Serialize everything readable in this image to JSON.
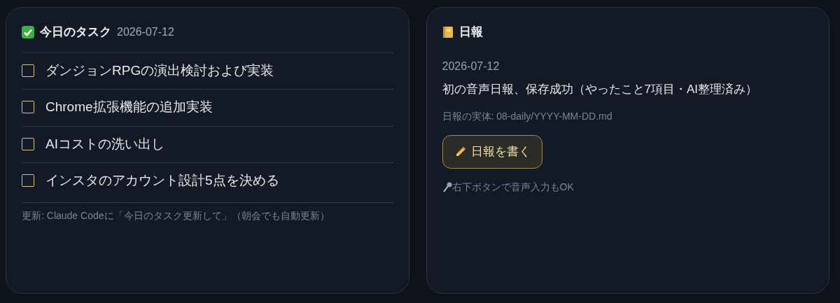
{
  "tasks_card": {
    "title": "今日のタスク",
    "date": "2026-07-12",
    "tasks": [
      {
        "label": "ダンジョンRPGの演出検討および実装",
        "checked": false
      },
      {
        "label": "Chrome拡張機能の追加実装",
        "checked": false
      },
      {
        "label": "AIコストの洗い出し",
        "checked": false
      },
      {
        "label": "インスタのアカウント設計5点を決める",
        "checked": false
      }
    ],
    "note": "更新: Claude Codeに「今日のタスク更新して」（朝会でも自動更新）"
  },
  "daily_card": {
    "title": "日報",
    "date": "2026-07-12",
    "summary": "初の音声日報、保存成功（やったこと7項目・AI整理済み）",
    "path": "日報の実体: 08-daily/YYYY-MM-DD.md",
    "button": "日報を書く",
    "hint": "右下ボタンで音声入力もOK"
  }
}
